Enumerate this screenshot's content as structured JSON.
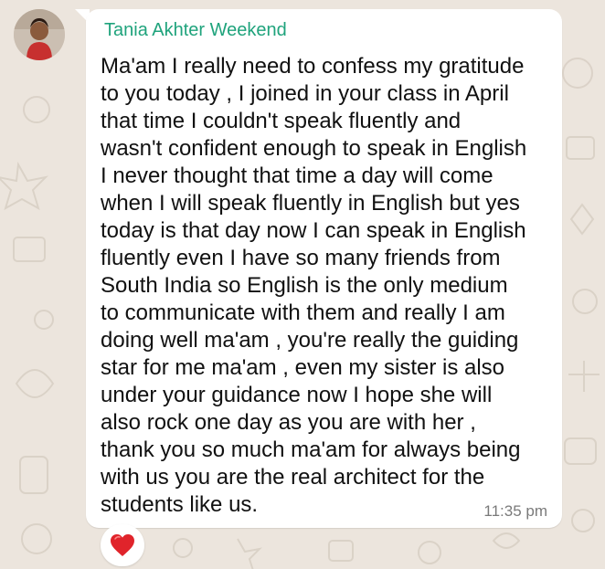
{
  "chat": {
    "sender_name": "Tania Akhter Weekend",
    "avatar_icon": "profile-photo",
    "message_lines": [
      "Ma'am I really need to confess my gratitude",
      "to you today , I joined in your class in April",
      "that time I couldn't speak fluently and",
      "wasn't confident enough to speak in English",
      "I never thought that time a day will come",
      "when I will speak fluently in English but yes",
      "today is that day now I can speak in English",
      "fluently even I have so many friends from",
      "South India so English is the only medium",
      "to communicate with them and really I am",
      "doing well ma'am , you're really the guiding",
      "star for me ma'am , even my sister is also",
      "under your guidance now I hope she will",
      "also rock one day as you are with her ,",
      "thank you so much ma'am for always being",
      "with us you are the real architect for the",
      "students like us."
    ],
    "timestamp": "11:35 pm",
    "reaction_icon": "red-heart-icon"
  },
  "colors": {
    "wallpaper": "#ece5dd",
    "bubble": "#ffffff",
    "sender_name": "#1fa37c",
    "timestamp": "#7a7a7a",
    "heart": "#e0242b"
  }
}
